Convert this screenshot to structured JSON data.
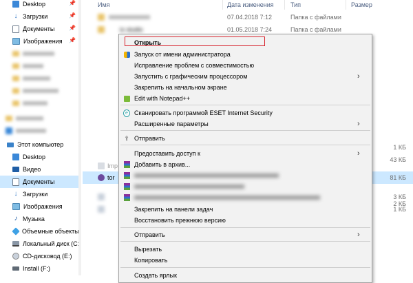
{
  "sidebar": {
    "quick_access": [
      {
        "label": "Desktop",
        "icon": "desktop-folder-icon",
        "pinned": true
      },
      {
        "label": "Загрузки",
        "icon": "downloads-icon",
        "pinned": true
      },
      {
        "label": "Документы",
        "icon": "documents-icon",
        "pinned": true
      },
      {
        "label": "Изображения",
        "icon": "pictures-icon",
        "pinned": true
      }
    ],
    "this_pc": {
      "label": "Этот компьютер",
      "items": [
        {
          "label": "Desktop",
          "icon": "desktop-folder-icon"
        },
        {
          "label": "Видео",
          "icon": "videos-icon"
        },
        {
          "label": "Документы",
          "icon": "documents-icon",
          "selected": true
        },
        {
          "label": "Загрузки",
          "icon": "downloads-icon"
        },
        {
          "label": "Изображения",
          "icon": "pictures-icon"
        },
        {
          "label": "Музыка",
          "icon": "music-icon"
        },
        {
          "label": "Объемные объекты",
          "icon": "3d-objects-icon"
        },
        {
          "label": "Локальный диск (C:",
          "icon": "local-disk-icon"
        },
        {
          "label": "CD-дисковод (E:)",
          "icon": "cd-drive-icon"
        },
        {
          "label": "Install (F:)",
          "icon": "usb-drive-icon"
        }
      ]
    }
  },
  "columns": {
    "name": "Имя",
    "date": "Дата изменения",
    "type": "Тип",
    "size": "Размер"
  },
  "files": [
    {
      "date": "07.04.2018 7:12",
      "type": "Папка с файлами"
    },
    {
      "name_partial": "io studio",
      "date": "01.05.2018 7:24",
      "type": "Папка с файлами"
    }
  ],
  "visible_rows": {
    "row_imp": "Imp",
    "row_tor": "tor",
    "sizes": [
      "1 КБ",
      "43 КБ",
      "81 КБ",
      "3 КБ",
      "2 КБ",
      "1 КБ"
    ]
  },
  "context_menu": {
    "items": [
      {
        "label": "Открыть",
        "bold": true,
        "highlighted": true
      },
      {
        "label": "Запуск от имени администратора",
        "icon": "uac-shield-icon"
      },
      {
        "label": "Исправление проблем с совместимостью"
      },
      {
        "label": "Запустить с графическим процессором",
        "submenu": true
      },
      {
        "label": "Закрепить на начальном экране"
      },
      {
        "label": "Edit with Notepad++",
        "icon": "notepad-plus-plus-icon"
      },
      {
        "label": "Сканировать программой ESET Internet Security",
        "icon": "eset-icon"
      },
      {
        "label": "Расширенные параметры",
        "submenu": true
      },
      {
        "label": "Отправить",
        "icon": "share-icon"
      },
      {
        "label": "Предоставить доступ к",
        "submenu": true
      },
      {
        "label": "Добавить в архив...",
        "icon": "winrar-icon"
      },
      {
        "label": "Закрепить на панели задач"
      },
      {
        "label": "Восстановить прежнюю версию"
      },
      {
        "label": "Отправить",
        "submenu": true
      },
      {
        "label": "Вырезать"
      },
      {
        "label": "Копировать"
      },
      {
        "label": "Создать ярлык"
      }
    ]
  },
  "colors": {
    "selection": "#cce8ff",
    "highlight_border": "#d6212b",
    "menu_background": "#f2f2f2"
  }
}
